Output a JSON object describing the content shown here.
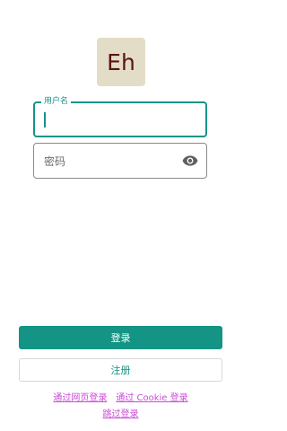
{
  "logo": {
    "text": "Eh"
  },
  "username_field": {
    "label": "用户名",
    "value": ""
  },
  "password_field": {
    "placeholder": "密码",
    "value": ""
  },
  "buttons": {
    "login": "登录",
    "register": "注册"
  },
  "links": {
    "web_login": "通过网页登录",
    "cookie_login": "通过 Cookie 登录",
    "skip_login": "跳过登录"
  },
  "colors": {
    "accent": "#149484",
    "link": "#c94bd6",
    "logo_bg": "#e3ddc7",
    "logo_text": "#5b1414"
  },
  "icons": {
    "password_visibility": "eye-icon"
  }
}
